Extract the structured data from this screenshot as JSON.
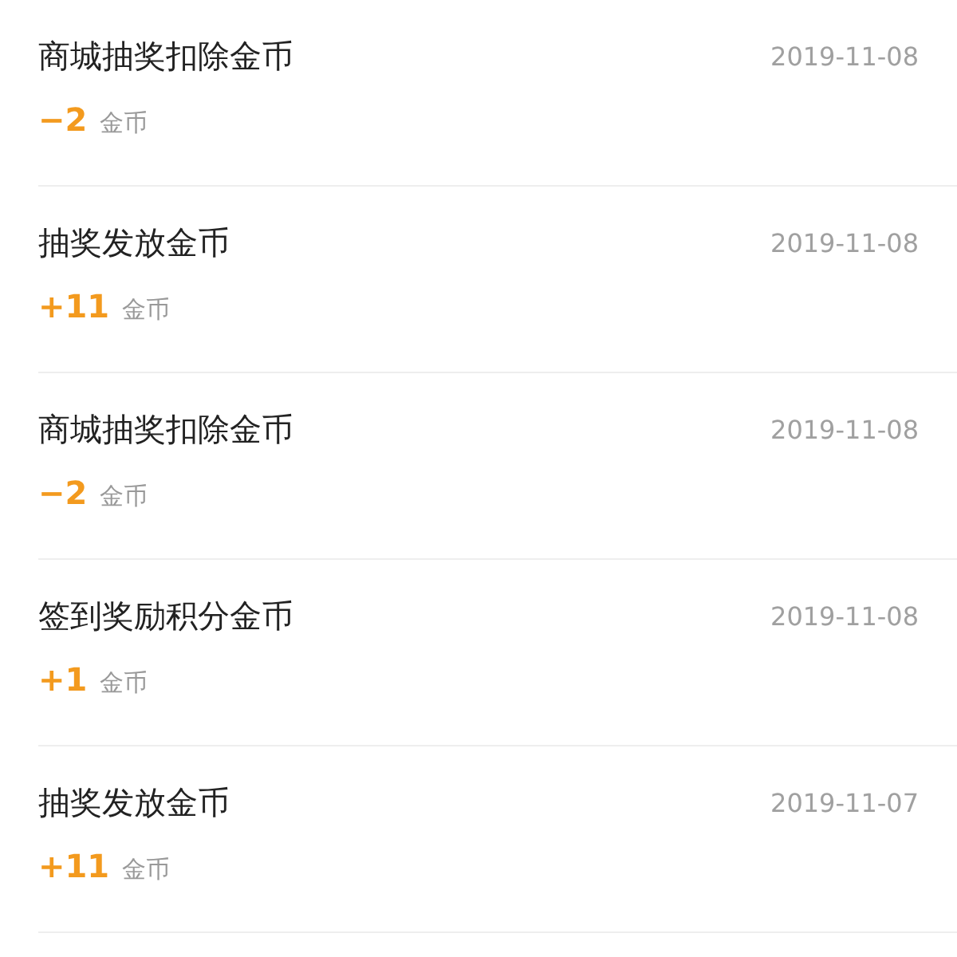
{
  "records": [
    {
      "title": "商城抽奖扣除金币",
      "date": "2019-11-08",
      "amount": "−2",
      "unit": "金币"
    },
    {
      "title": "抽奖发放金币",
      "date": "2019-11-08",
      "amount": "+11",
      "unit": "金币"
    },
    {
      "title": "商城抽奖扣除金币",
      "date": "2019-11-08",
      "amount": "−2",
      "unit": "金币"
    },
    {
      "title": "签到奖励积分金币",
      "date": "2019-11-08",
      "amount": "+1",
      "unit": "金币"
    },
    {
      "title": "抽奖发放金币",
      "date": "2019-11-07",
      "amount": "+11",
      "unit": "金币"
    }
  ]
}
